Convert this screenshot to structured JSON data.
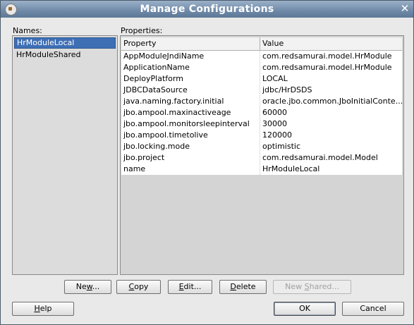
{
  "window": {
    "title": "Manage Configurations",
    "close_glyph": "✕"
  },
  "names": {
    "label": "Names:",
    "items": [
      "HrModuleLocal",
      "HrModuleShared"
    ],
    "selected_index": 0
  },
  "properties": {
    "label": "Properties:",
    "columns": [
      "Property",
      "Value"
    ],
    "rows": [
      [
        "AppModuleJndiName",
        "com.redsamurai.model.HrModule"
      ],
      [
        "ApplicationName",
        "com.redsamurai.model.HrModule"
      ],
      [
        "DeployPlatform",
        "LOCAL"
      ],
      [
        "JDBCDataSource",
        "jdbc/HrDSDS"
      ],
      [
        "java.naming.factory.initial",
        "oracle.jbo.common.JboInitialConte..."
      ],
      [
        "jbo.ampool.maxinactiveage",
        "60000"
      ],
      [
        "jbo.ampool.monitorsleepinterval",
        "30000"
      ],
      [
        "jbo.ampool.timetolive",
        "120000"
      ],
      [
        "jbo.locking.mode",
        "optimistic"
      ],
      [
        "jbo.project",
        "com.redsamurai.model.Model"
      ],
      [
        "name",
        "HrModuleLocal"
      ]
    ]
  },
  "actions": {
    "new_pre": "Ne",
    "new_u": "w",
    "new_post": "...",
    "copy_u": "C",
    "copy_post": "opy",
    "edit_u": "E",
    "edit_post": "dit...",
    "delete_u": "D",
    "delete_post": "elete",
    "newshared_pre": "New ",
    "newshared_u": "S",
    "newshared_post": "hared..."
  },
  "footer": {
    "help_u": "H",
    "help_post": "elp",
    "ok_label": "OK",
    "cancel_label": "Cancel"
  },
  "colors": {
    "selection": "#3e6fb5",
    "titlebar": "#6f8aa8"
  }
}
